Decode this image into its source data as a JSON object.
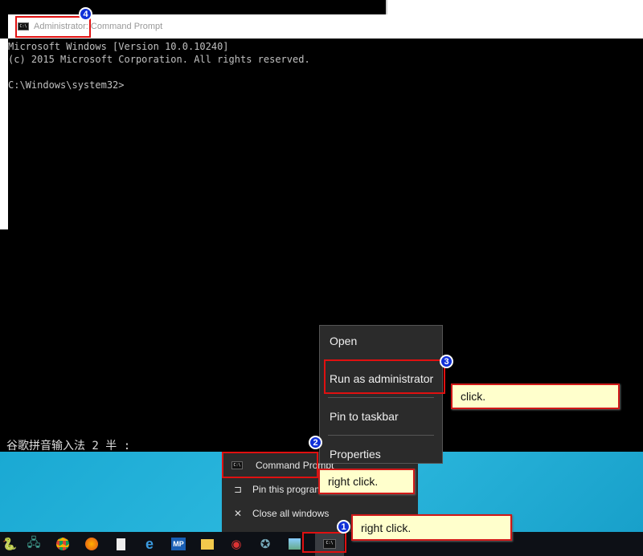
{
  "window": {
    "title": "Administrator: Command Prompt",
    "icon": "cmd-icon"
  },
  "console": {
    "lines": [
      "Microsoft Windows [Version 10.0.10240]",
      "(c) 2015 Microsoft Corporation. All rights reserved.",
      "",
      "C:\\Windows\\system32>"
    ]
  },
  "ime": {
    "text": "谷歌拼音输入法 2 半 :"
  },
  "jump_list": {
    "items": [
      {
        "label": "Command Prompt",
        "icon": "cmd-icon"
      },
      {
        "label": "Pin this program",
        "icon": "pin-icon"
      },
      {
        "label": "Close all windows",
        "icon": "close-icon"
      }
    ]
  },
  "context_menu": {
    "items": [
      "Open",
      "Run as administrator",
      "Pin to taskbar",
      "Properties"
    ]
  },
  "taskbar": {
    "icons": [
      "python-icon",
      "network-icon",
      "chrome-icon",
      "firefox-icon",
      "file-icon",
      "ie-icon",
      "mp-icon",
      "explorer-icon",
      "snail-icon",
      "app-icon",
      "paint-icon",
      "cmd-icon"
    ]
  },
  "annotations": {
    "step1": {
      "num": "1",
      "text": "right click."
    },
    "step2": {
      "num": "2",
      "text": "right click."
    },
    "step3": {
      "num": "3",
      "text": "click."
    },
    "step4": {
      "num": "4"
    }
  },
  "colors": {
    "callout_bg": "#ffffcc",
    "callout_border": "#e01010",
    "badge": "#1030d8"
  }
}
